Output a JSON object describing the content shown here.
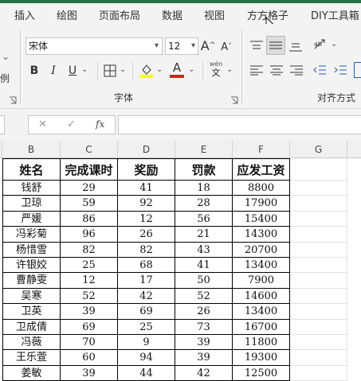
{
  "tabs": [
    "插入",
    "绘图",
    "页面布局",
    "数据",
    "视图",
    "方方格子",
    "DIY工具箱"
  ],
  "font": {
    "name": "宋体",
    "size": "12",
    "group_label": "字体",
    "grow": "A",
    "shrink": "A"
  },
  "format_buttons": {
    "bold": "B",
    "italic": "I",
    "underline": "U",
    "font_color": "A",
    "phonetic_top": "wén",
    "phonetic_bottom": "文"
  },
  "align_group_label": "对齐方式",
  "side_marks": {
    "left_top": "⌄",
    "left_bottom": "例"
  },
  "formula": {
    "cancel": "✕",
    "confirm": "✓",
    "fx": "fx",
    "value": ""
  },
  "colors": {
    "highlight": "#ffff00",
    "font_color": "#e0201c",
    "accent": "#217346"
  },
  "columns": [
    "B",
    "C",
    "D",
    "E",
    "F",
    "G"
  ],
  "table": {
    "headers": [
      "姓名",
      "完成课时",
      "奖励",
      "罚款",
      "应发工资"
    ],
    "rows": [
      [
        "钱舒",
        "29",
        "41",
        "18",
        "8800"
      ],
      [
        "卫琼",
        "59",
        "92",
        "28",
        "17900"
      ],
      [
        "严媛",
        "86",
        "12",
        "56",
        "15400"
      ],
      [
        "冯彩菊",
        "96",
        "26",
        "21",
        "14300"
      ],
      [
        "杨惜雪",
        "82",
        "82",
        "43",
        "20700"
      ],
      [
        "许银姣",
        "25",
        "68",
        "41",
        "13400"
      ],
      [
        "曹静雯",
        "12",
        "17",
        "50",
        "7900"
      ],
      [
        "吴寒",
        "52",
        "42",
        "52",
        "14600"
      ],
      [
        "卫英",
        "39",
        "69",
        "26",
        "13400"
      ],
      [
        "卫成倩",
        "69",
        "25",
        "73",
        "16700"
      ],
      [
        "冯薇",
        "70",
        "9",
        "39",
        "11800"
      ],
      [
        "王乐萱",
        "60",
        "94",
        "39",
        "19300"
      ],
      [
        "姜敏",
        "39",
        "44",
        "42",
        "12500"
      ]
    ]
  }
}
